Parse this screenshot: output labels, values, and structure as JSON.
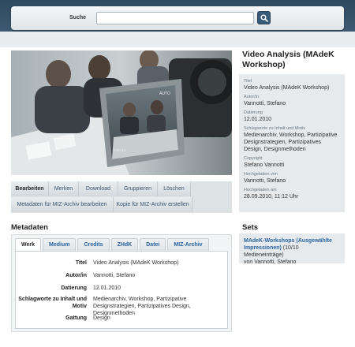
{
  "search": {
    "label": "Suche",
    "value": ""
  },
  "media_entry": {
    "title": "Video Analysis (MAdeK Workshop)"
  },
  "actions": [
    {
      "label": "Bearbeiten"
    },
    {
      "label": "Merken"
    },
    {
      "label": "Download"
    },
    {
      "label": "Gruppieren"
    },
    {
      "label": "Löschen"
    },
    {
      "label": "Metadaten für MIZ-Archiv bearbeiten"
    },
    {
      "label": "Kopie für MIZ-Archiv erstellen"
    }
  ],
  "sidebar_meta": [
    {
      "label": "Titel",
      "value": "Video Analysis (MAdeK Workshop)"
    },
    {
      "label": "Autor/in",
      "value": "Vannotti, Stefano"
    },
    {
      "label": "Datierung",
      "value": "12.01.2010"
    },
    {
      "label": "Schlagworte zu Inhalt und Motiv",
      "value": "Medienarchiv, Workshop, Partizipative Designstrategien, Partizipatives Design, Designmethoden"
    },
    {
      "label": "Copyright",
      "value": "Stefano Vannotti"
    },
    {
      "label": "Hochgeladen von",
      "value": "Vannotti, Stefano"
    },
    {
      "label": "Hochgeladen am",
      "value": "28.09.2010, 11:12 Uhr"
    }
  ],
  "sets": {
    "heading": "Sets",
    "set_title": "MAdeK-Workshops (Ausgewählte Impressionen)",
    "set_count": " (10/10 Medieneinträge)",
    "set_owner": "von Vannotti, Stefano"
  },
  "metadata": {
    "heading": "Metadaten",
    "tabs": [
      "Werk",
      "Medium",
      "Credits",
      "ZHdK",
      "Datei",
      "MIZ-Archiv"
    ],
    "rows": [
      {
        "key": "Titel",
        "value": "Video Analysis (MAdeK Workshop)"
      },
      {
        "key": "Autor/in",
        "value": "Vannotti, Stefano"
      },
      {
        "key": "Datierung",
        "value": "12.01.2010"
      },
      {
        "key": "Schlagworte zu Inhalt und Motiv",
        "value": "Medienarchiv, Workshop, Partizipative Designstrategien, Partizipatives Design, Designmethoden"
      },
      {
        "key": "Gattung",
        "value": "Design"
      }
    ]
  },
  "colors": {
    "header": "#2f4a60",
    "link": "#2a64a0",
    "panel": "#e6eaec"
  },
  "icons": {
    "search_button": "search-icon"
  }
}
